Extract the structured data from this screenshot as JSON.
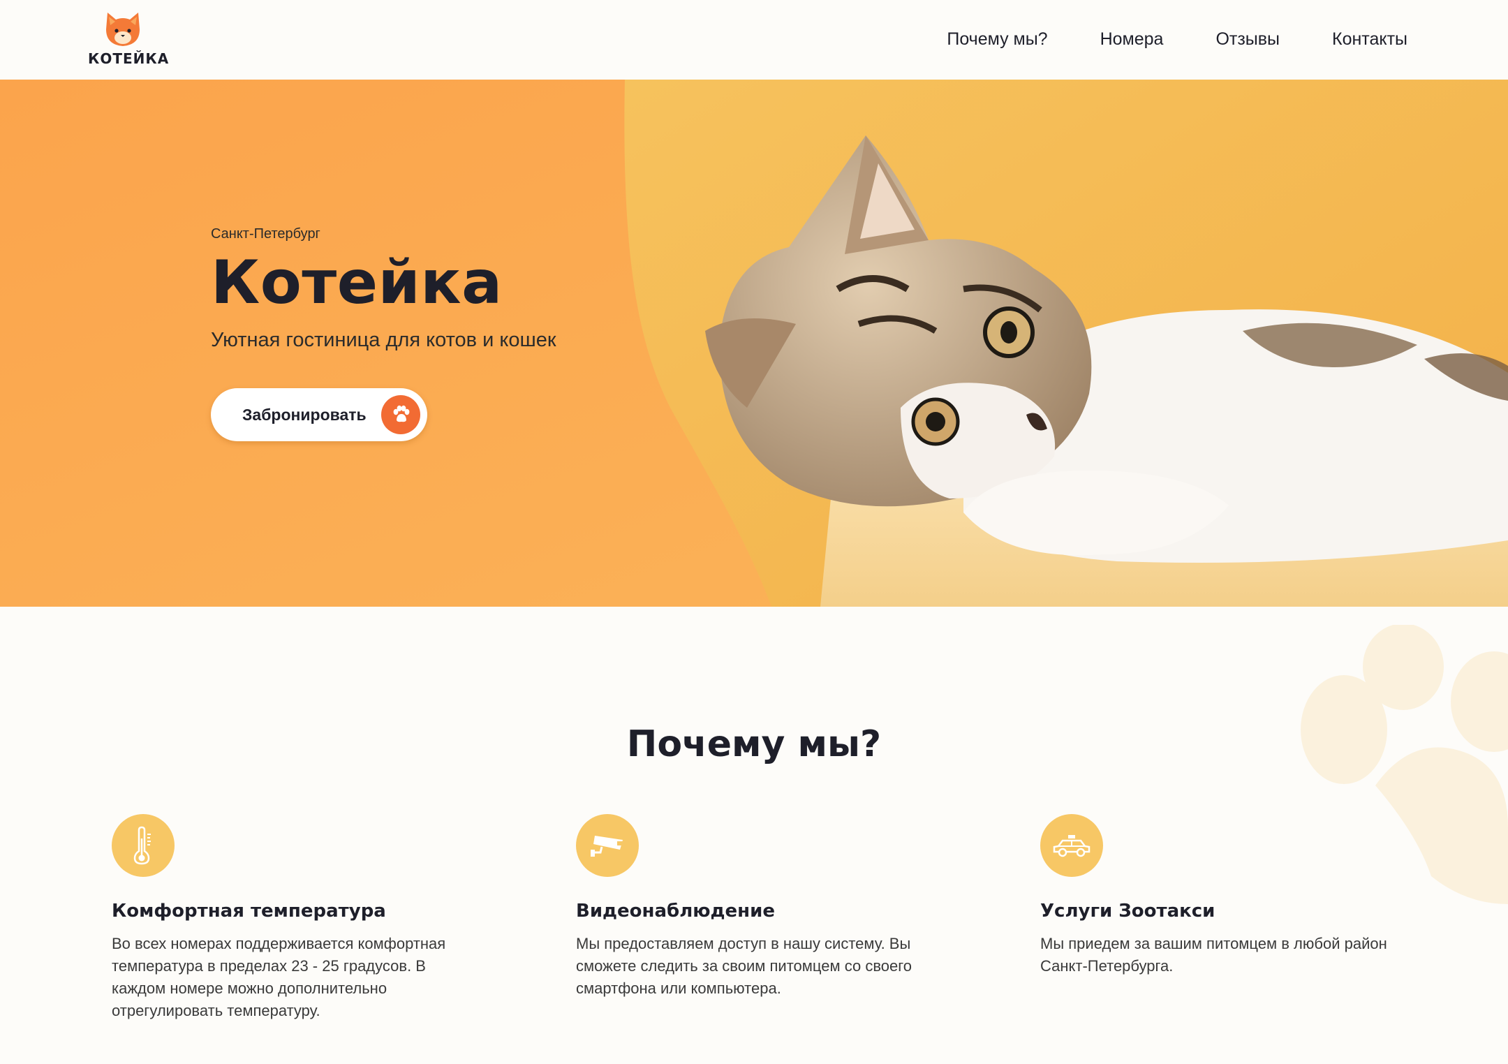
{
  "header": {
    "logo_text": "КОТЕЙКА",
    "nav": [
      {
        "label": "Почему мы?"
      },
      {
        "label": "Номера"
      },
      {
        "label": "Отзывы"
      },
      {
        "label": "Контакты"
      }
    ]
  },
  "hero": {
    "city": "Санкт-Петербург",
    "title": "Котейка",
    "subtitle": "Уютная гостиница для котов и кошек",
    "button_label": "Забронировать"
  },
  "why": {
    "title": "Почему мы?",
    "features": [
      {
        "icon": "thermometer-icon",
        "title": "Комфортная температура",
        "text": "Во всех номерах поддерживается комфортная температура в пределах 23 - 25 градусов. В каждом номере можно дополнительно отрегулировать температуру."
      },
      {
        "icon": "camera-icon",
        "title": "Видеонаблюдение",
        "text": "Мы предоставляем доступ в нашу систему. Вы сможете следить за своим питомцем со своего смартфона или компьютера."
      },
      {
        "icon": "taxi-icon",
        "title": "Услуги Зоотакси",
        "text": "Мы приедем за вашим питомцем в любой район Санкт-Петербурга."
      }
    ]
  },
  "colors": {
    "accent_orange": "#f26b33",
    "hero_orange": "#fba44c",
    "icon_yellow": "#f7c765",
    "text_dark": "#1e1f2a",
    "background": "#fdfcf9"
  }
}
